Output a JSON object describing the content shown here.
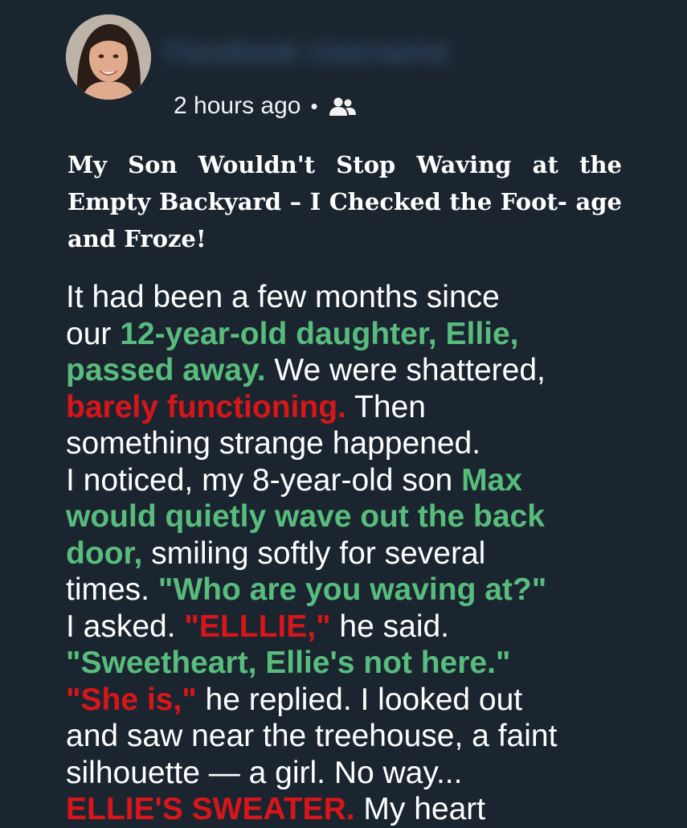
{
  "post": {
    "author_name": "Facebook Username",
    "timestamp": "2 hours ago",
    "separator": "•",
    "audience_icon": "friends-icon",
    "headline_lines": [
      "My Son Wouldn't Stop Waving at the",
      "Empty Backyard – I Checked the Foot-",
      "age and Froze!"
    ]
  },
  "story": {
    "line1": "It had been a few months since",
    "line2_a": "our ",
    "line2_b": "12-year-old daughter, Ellie,",
    "line3_a": "passed away.",
    "line3_b": " We were shattered,",
    "line4_a": "barely functioning.",
    "line4_b": " Then",
    "line5": "something strange happened.",
    "line6_a": "I noticed, my 8-year-old son ",
    "line6_b": "Max",
    "line7": "would quietly wave out the back",
    "line8_a": "door,",
    "line8_b": " smiling softly for several",
    "line9_a": "times. ",
    "line9_b": "\"Who are you waving at?\"",
    "line10_a": "I asked. ",
    "line10_b": "\"ELLLIE,\"",
    "line10_c": " he said.",
    "line11": "\"Sweetheart, Ellie's not here.\"",
    "line12_a": "\"She is,\"",
    "line12_b": " he replied. I looked out",
    "line13": "and saw near the treehouse, a faint",
    "line14": "silhouette — a girl. No way...",
    "line15_a": "ELLIE'S SWEATER.",
    "line15_b": " My heart"
  },
  "colors": {
    "background": "#1b2530",
    "highlight_green": "#58bc7d",
    "highlight_red": "#d8161a"
  }
}
